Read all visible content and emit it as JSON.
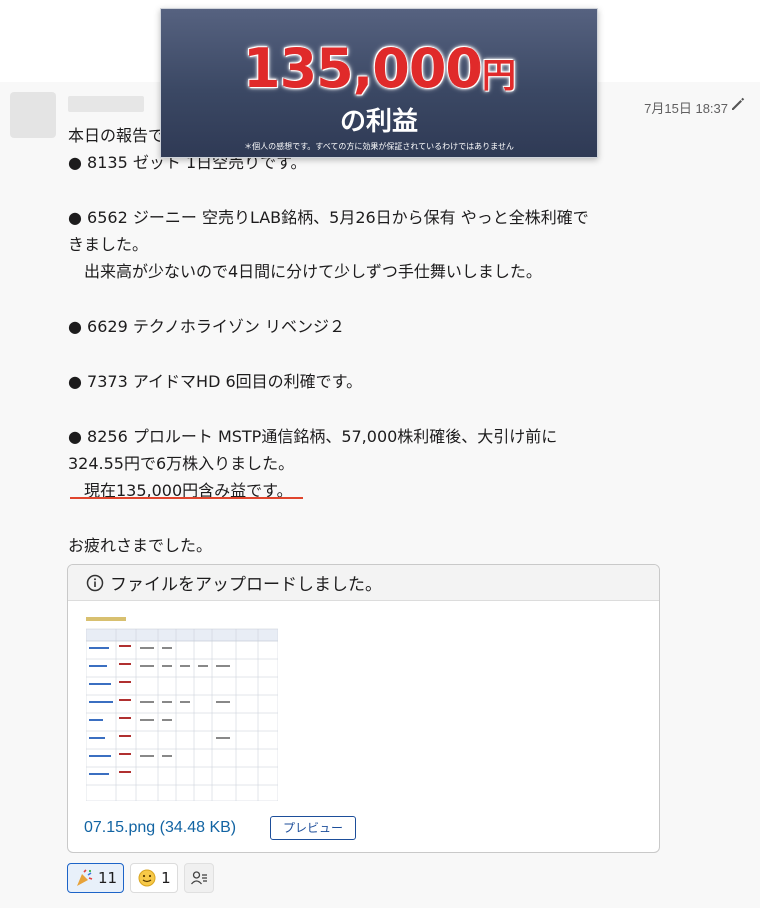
{
  "banner": {
    "amount": "135,000",
    "yen": "円",
    "subtitle": "の利益",
    "note": "＊個人の感想です。すべての方に効果が保証されているわけではありません"
  },
  "message": {
    "timestamp": "7月15日 18:37",
    "lines": [
      "本日の報告です。",
      "● 8135 ゼット 1日空売りです。",
      "",
      "● 6562 ジーニー 空売りLAB銘柄、5月26日から保有 やっと全株利確で",
      "きました。",
      "　出来高が少ないので4日間に分けて少しずつ手仕舞いしました。",
      "",
      "● 6629 テクノホライゾン リベンジ２",
      "",
      "● 7373 アイドマHD 6回目の利確です。",
      "",
      "● 8256 プロルート MSTP通信銘柄、57,000株利確後、大引け前に",
      "324.55円で6万株入りました。",
      "　現在135,000円含み益です。",
      "",
      "お疲れさまでした。"
    ]
  },
  "file": {
    "header": "ファイルをアップロードしました。",
    "name": "07.15.png (34.48 KB)",
    "preview_label": "プレビュー"
  },
  "reactions": [
    {
      "icon": "party-popper-icon",
      "count": "11"
    },
    {
      "icon": "face-emoji-icon",
      "count": "1"
    },
    {
      "icon": "user-list-icon",
      "count": ""
    }
  ],
  "colors": {
    "accent_red": "#e02a2a",
    "link_blue": "#1264a3",
    "underline_red": "#e0452d"
  }
}
